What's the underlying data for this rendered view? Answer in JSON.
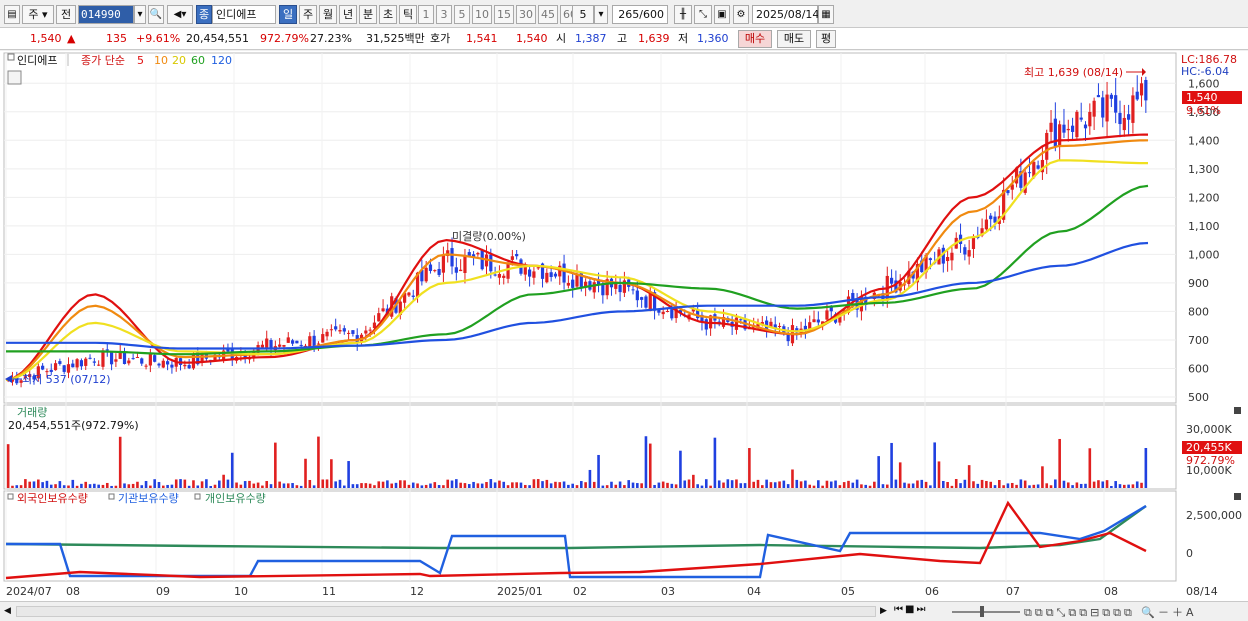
{
  "toolbar": {
    "market": "주",
    "prev": "전",
    "code": "014990",
    "name_tag": "종",
    "stock_name": "인디에프",
    "periods": [
      "일",
      "주",
      "월",
      "년",
      "분",
      "초",
      "틱"
    ],
    "active_period": "일",
    "intervals": [
      "1",
      "3",
      "5",
      "10",
      "15",
      "30",
      "45",
      "60"
    ],
    "count_select": "5",
    "range": "265/600",
    "date": "2025/08/14"
  },
  "quote": {
    "price": "1,540",
    "change_arrow": "▲",
    "change": "135",
    "change_pct": "+9.61%",
    "volume": "20,454,551",
    "volume_ratio": "972.79%",
    "turnover": "27.23%",
    "amount": "31,525백만",
    "hoga_label": "호가",
    "ask": "1,541",
    "bid": "1,540",
    "open_label": "시",
    "open": "1,387",
    "high_label": "고",
    "high": "1,639",
    "low_label": "저",
    "low": "1,360",
    "buy_button": "매수",
    "sell_button": "매도",
    "eval_button": "평"
  },
  "price_panel": {
    "legend_name": "인디에프",
    "legend_ma_label": "종가 단순",
    "legend_ma": [
      "5",
      "10",
      "20",
      "60",
      "120"
    ],
    "lc": "LC:186.78",
    "hc": "HC:-6.04",
    "high_note": "최고 1,639 (08/14)",
    "low_note": "최저 537 (07/12)",
    "pending_label": "미결량(0.00%)",
    "last_price_tag": "1,540",
    "last_pct_tag": "9.61%",
    "y_ticks": [
      "1,600",
      "1,500",
      "1,400",
      "1,300",
      "1,200",
      "1,100",
      "1,000",
      "900",
      "800",
      "700",
      "600",
      "500"
    ]
  },
  "volume_panel": {
    "title": "거래량",
    "value": "20,454,551주(972.79%)",
    "ticks": [
      "30,000K",
      "10,000K"
    ],
    "last_tag": "20,455K",
    "last_pct": "972.79%"
  },
  "holdings_panel": {
    "series": [
      "외국인보유수량",
      "기관보유수량",
      "개인보유수량"
    ],
    "ticks": [
      "2,500,000",
      "0"
    ]
  },
  "x_axis": [
    "2024/07",
    "08",
    "09",
    "10",
    "11",
    "12",
    "2025/01",
    "02",
    "03",
    "04",
    "05",
    "06",
    "07",
    "08",
    "08/14"
  ],
  "colors": {
    "up": "#e02020",
    "down": "#2040e0",
    "ma5": "#e01010",
    "ma10": "#f08a10",
    "ma20": "#f0e020",
    "ma60": "#20a020",
    "ma120": "#2050e0",
    "foreign": "#e01010",
    "inst": "#2060e0",
    "indiv": "#2e8a5a"
  },
  "chart_data": {
    "type": "candlestick",
    "title": "인디에프",
    "ylim": [
      500,
      1650
    ],
    "months": [
      "2024/07",
      "08",
      "09",
      "10",
      "11",
      "12",
      "2025/01",
      "02",
      "03",
      "04",
      "05",
      "06",
      "07",
      "08"
    ],
    "close_monthly": [
      560,
      640,
      620,
      680,
      720,
      980,
      960,
      880,
      760,
      720,
      880,
      1050,
      1450,
      1540
    ],
    "ma_series": [
      {
        "name": "5",
        "values": [
          560,
          860,
          620,
          640,
          700,
          1050,
          960,
          900,
          760,
          720,
          880,
          1200,
          1400,
          1420
        ]
      },
      {
        "name": "10",
        "values": [
          560,
          820,
          640,
          650,
          700,
          1000,
          960,
          900,
          780,
          720,
          860,
          1150,
          1380,
          1400
        ]
      },
      {
        "name": "20",
        "values": [
          560,
          760,
          660,
          650,
          690,
          900,
          960,
          920,
          800,
          730,
          840,
          1060,
          1330,
          1320
        ]
      },
      {
        "name": "60",
        "values": [
          660,
          660,
          650,
          660,
          680,
          720,
          860,
          900,
          880,
          810,
          830,
          880,
          1080,
          1240
        ]
      },
      {
        "name": "120",
        "values": [
          690,
          690,
          670,
          670,
          680,
          700,
          760,
          800,
          820,
          820,
          850,
          900,
          960,
          1040
        ]
      }
    ],
    "high": 1639,
    "low": 537
  }
}
